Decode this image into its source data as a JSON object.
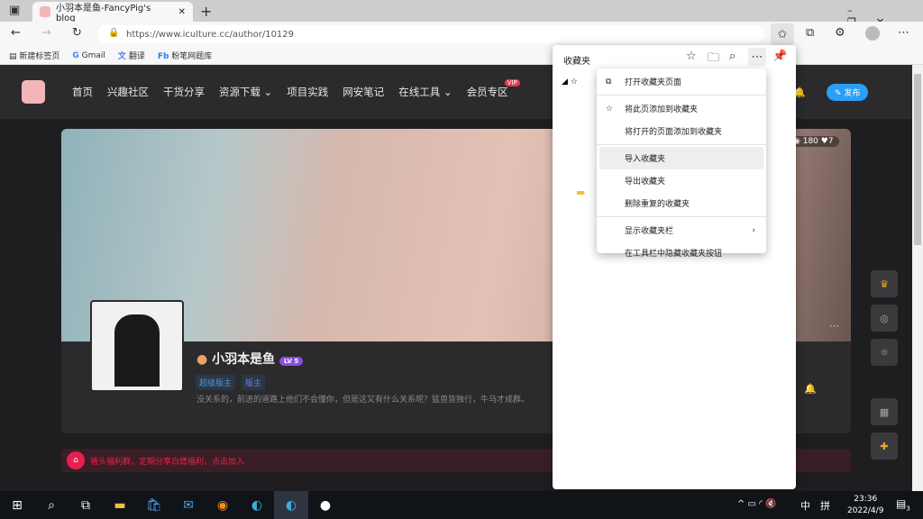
{
  "browser": {
    "tab_title": "小羽本是鱼-FancyPig's blog",
    "url": "https://www.iculture.cc/author/10129",
    "bookmarks": [
      "新建标签页",
      "Gmail",
      "翻译",
      "粉笔网题库"
    ]
  },
  "site": {
    "nav": [
      "首页",
      "兴趣社区",
      "干货分享",
      "资源下载",
      "项目实践",
      "网安笔记",
      "在线工具",
      "会员专区"
    ],
    "vip_badge": "VIP",
    "publish": "发布",
    "stats": {
      "views": "180",
      "likes": "7"
    }
  },
  "profile": {
    "name": "小羽本是鱼",
    "level": "LV 5",
    "badges": [
      "超级版主",
      "版主"
    ],
    "bio": "没关系的，前进的道路上他们不会懂你，但是这又有什么关系呢？猛兽皆独行，牛马才成群。"
  },
  "banner": "猪头福利群，定期分享白嫖福利，点击加入",
  "favorites": {
    "title": "收藏夹",
    "menu": [
      "打开收藏夹页面",
      "将此页添加到收藏夹",
      "将打开的页面添加到收藏夹",
      "导入收藏夹",
      "导出收藏夹",
      "删除重复的收藏夹",
      "显示收藏夹栏",
      "在工具栏中隐藏收藏夹按钮"
    ]
  },
  "taskbar": {
    "time": "23:36",
    "date": "2022/4/9",
    "ime": "中",
    "ime2": "拼",
    "notifications": "3"
  }
}
